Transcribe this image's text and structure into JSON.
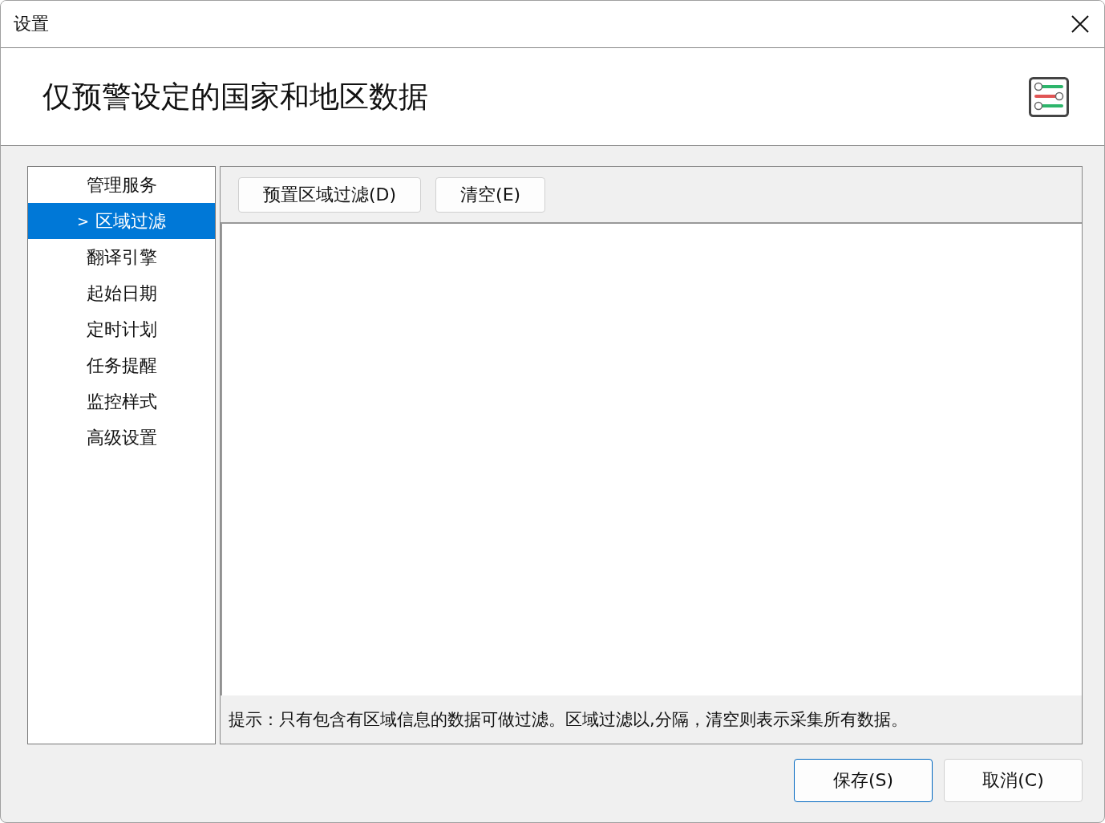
{
  "window": {
    "title": "设置"
  },
  "header": {
    "title": "仅预警设定的国家和地区数据"
  },
  "sidebar": {
    "items": [
      {
        "label": "管理服务",
        "selected": false
      },
      {
        "label": "区域过滤",
        "selected": true,
        "marker": ">"
      },
      {
        "label": "翻译引擎",
        "selected": false
      },
      {
        "label": "起始日期",
        "selected": false
      },
      {
        "label": "定时计划",
        "selected": false
      },
      {
        "label": "任务提醒",
        "selected": false
      },
      {
        "label": "监控样式",
        "selected": false
      },
      {
        "label": "高级设置",
        "selected": false
      }
    ]
  },
  "panel": {
    "buttons": [
      "预置区域过滤(D)",
      "清空(E)"
    ],
    "hint": "提示：只有包含有区域信息的数据可做过滤。区域过滤以,分隔，清空则表示采集所有数据。"
  },
  "footer": {
    "buttons": [
      {
        "label": "保存(S)",
        "default": true
      },
      {
        "label": "取消(C)",
        "default": false
      }
    ]
  }
}
